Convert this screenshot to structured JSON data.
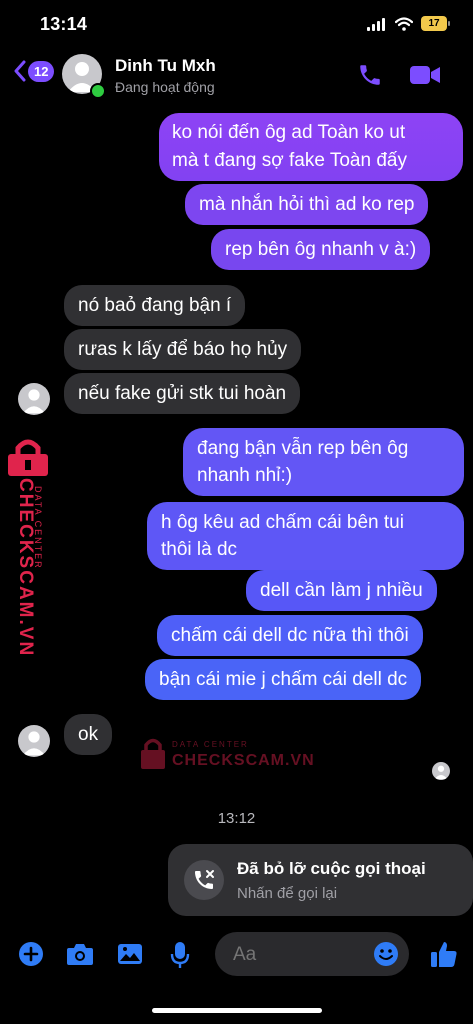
{
  "status_bar": {
    "time": "13:14",
    "battery": "17"
  },
  "header": {
    "unread_count": "12",
    "contact_name": "Dinh Tu Mxh",
    "contact_status": "Đang hoạt động"
  },
  "colors": {
    "accent": "#7c4dff",
    "incoming_bubble": "#303033",
    "background": "#000000"
  },
  "messages_out_1": [
    "ko nói đến ôg ad Toàn ko ut",
    "mà t đang sợ fake Toàn đấy",
    "mà nhắn hỏi thì ad ko rep",
    "rep bên ôg nhanh v à:)"
  ],
  "messages_in_1": [
    "nó baỏ đang bận í",
    "rưas k lấy để báo họ hủy",
    "nếu fake gửi stk tui hoàn"
  ],
  "messages_out_2": [
    "đang bận vẫn rep bên ôg",
    "nhanh nhỉ:)",
    "h ôg kêu ad chấm cái bên tui",
    "thôi là dc",
    "dell cần làm j nhiều",
    "chấm cái dell dc nữa thì thôi",
    "bận cái mie j chấm cái dell dc"
  ],
  "messages_in_2": [
    "ok"
  ],
  "watermark": {
    "line1": "DATA CENTER",
    "line2": "CHECKSCAM.VN"
  },
  "timestamp": "13:12",
  "missed_call": {
    "title": "Đã bỏ lỡ cuộc gọi thoại",
    "subtitle": "Nhấn để gọi lại"
  },
  "composer": {
    "placeholder": "Aa"
  }
}
